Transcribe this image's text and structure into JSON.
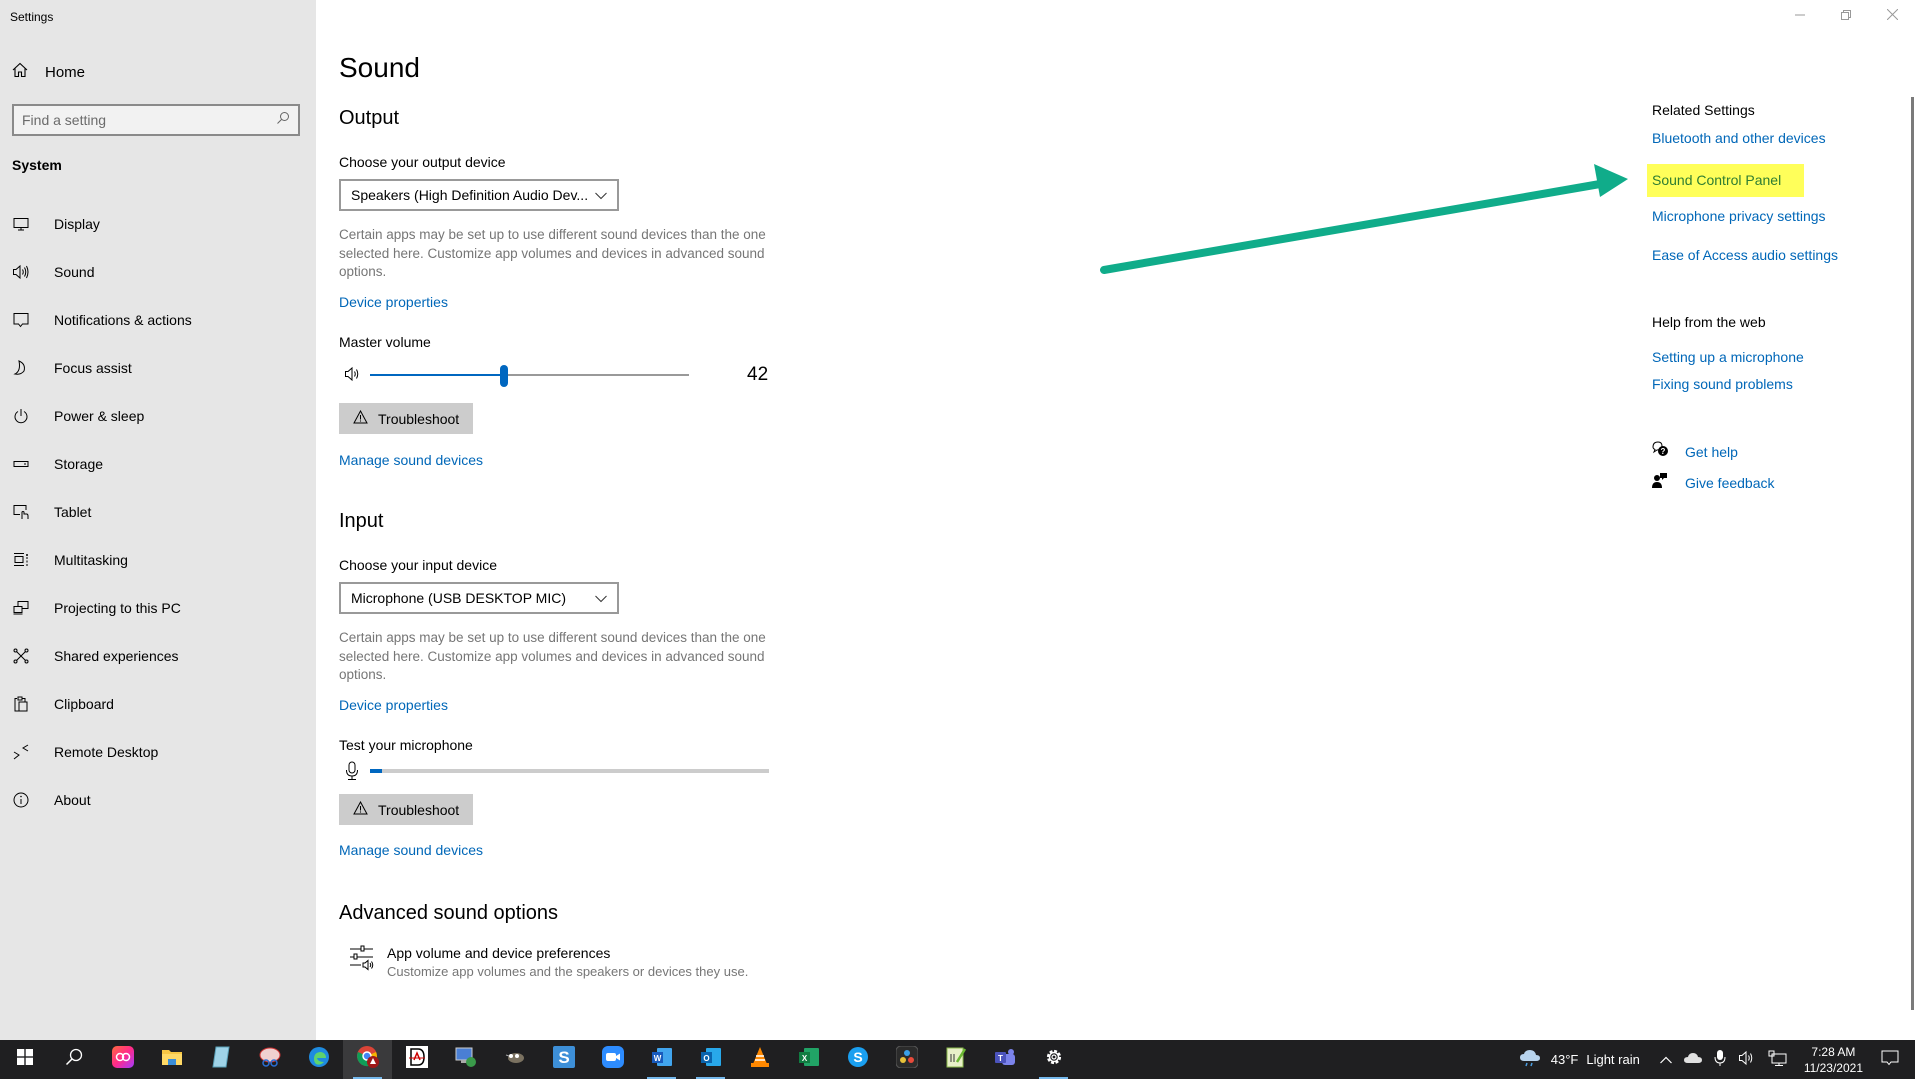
{
  "window": {
    "title": "Settings",
    "controls": {
      "minimize": "minimize",
      "restore": "restore",
      "close": "close"
    }
  },
  "sidebar": {
    "home_label": "Home",
    "search_placeholder": "Find a setting",
    "section_label": "System",
    "items": [
      {
        "label": "Display",
        "icon": "monitor-icon"
      },
      {
        "label": "Sound",
        "icon": "speaker-icon"
      },
      {
        "label": "Notifications & actions",
        "icon": "notification-icon"
      },
      {
        "label": "Focus assist",
        "icon": "moon-icon"
      },
      {
        "label": "Power & sleep",
        "icon": "power-icon"
      },
      {
        "label": "Storage",
        "icon": "storage-icon"
      },
      {
        "label": "Tablet",
        "icon": "tablet-icon"
      },
      {
        "label": "Multitasking",
        "icon": "multitasking-icon"
      },
      {
        "label": "Projecting to this PC",
        "icon": "projecting-icon"
      },
      {
        "label": "Shared experiences",
        "icon": "shared-experiences-icon"
      },
      {
        "label": "Clipboard",
        "icon": "clipboard-icon"
      },
      {
        "label": "Remote Desktop",
        "icon": "remote-desktop-icon"
      },
      {
        "label": "About",
        "icon": "info-icon"
      }
    ]
  },
  "main": {
    "title": "Sound",
    "output": {
      "heading": "Output",
      "device_label": "Choose your output device",
      "device_value": "Speakers (High Definition Audio Dev...",
      "description": "Certain apps may be set up to use different sound devices than the one selected here. Customize app volumes and devices in advanced sound options.",
      "device_properties": "Device properties",
      "master_volume_label": "Master volume",
      "master_volume_value": "42",
      "master_volume_percent": 42,
      "troubleshoot": "Troubleshoot",
      "manage_devices": "Manage sound devices"
    },
    "input": {
      "heading": "Input",
      "device_label": "Choose your input device",
      "device_value": "Microphone (USB DESKTOP MIC)",
      "description": "Certain apps may be set up to use different sound devices than the one selected here. Customize app volumes and devices in advanced sound options.",
      "device_properties": "Device properties",
      "test_label": "Test your microphone",
      "mic_level_percent": 3,
      "troubleshoot": "Troubleshoot",
      "manage_devices": "Manage sound devices"
    },
    "advanced": {
      "heading": "Advanced sound options",
      "item_title": "App volume and device preferences",
      "item_desc": "Customize app volumes and the speakers or devices they use."
    }
  },
  "related": {
    "heading": "Related Settings",
    "links": [
      "Bluetooth and other devices",
      "Sound Control Panel",
      "Microphone privacy settings",
      "Ease of Access audio settings"
    ],
    "highlighted_link": "Sound Control Panel",
    "highlight_color": "#ffff5a",
    "arrow_color": "#10ac8a",
    "help_heading": "Help from the web",
    "help_links": [
      "Setting up a microphone",
      "Fixing sound problems"
    ],
    "get_help": "Get help",
    "give_feedback": "Give feedback"
  },
  "colors": {
    "accent": "#0067c0",
    "link": "#0067b8",
    "sidebar_bg": "#e6e6e6",
    "taskbar_bg": "#1f1f21"
  },
  "taskbar": {
    "apps": [
      "start-icon",
      "search-icon",
      "creative-cloud-icon",
      "file-explorer-icon",
      "notepad-icon",
      "snipping-tool-icon",
      "edge-icon",
      "chrome-icon",
      "drawing-app-icon",
      "remote-app-icon",
      "gimp-icon",
      "snagit-icon",
      "zoom-icon",
      "word-icon",
      "outlook-icon",
      "vlc-icon",
      "excel-icon",
      "skype-icon",
      "davinci-resolve-icon",
      "notepad-plus-icon",
      "teams-icon",
      "settings-icon"
    ],
    "weather_temp": "43°F",
    "weather_desc": "Light rain",
    "time": "7:28 AM",
    "date": "11/23/2021"
  }
}
